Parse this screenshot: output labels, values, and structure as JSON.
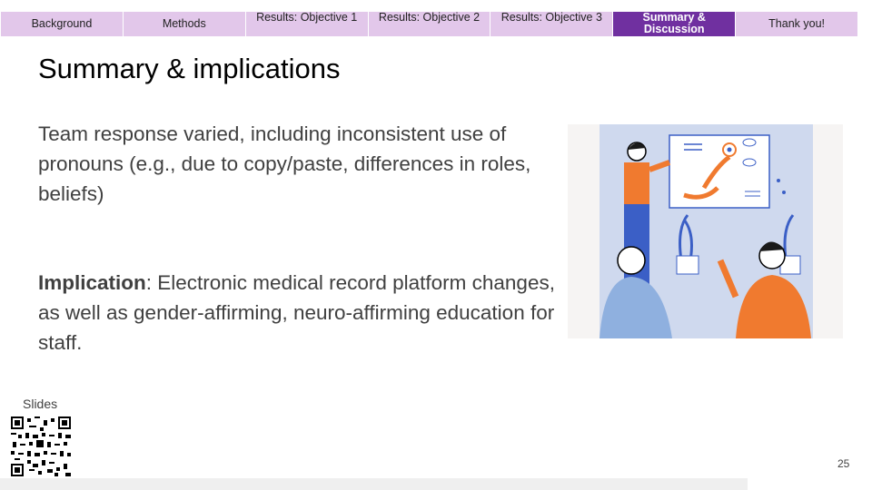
{
  "nav": {
    "tabs": [
      {
        "label": "Background",
        "active": false
      },
      {
        "label": "Methods",
        "active": false
      },
      {
        "label": "Results: Objective 1",
        "active": false
      },
      {
        "label": "Results: Objective 2",
        "active": false
      },
      {
        "label": "Results: Objective 3",
        "active": false
      },
      {
        "label": "Summary & Discussion",
        "active": true
      },
      {
        "label": "Thank you!",
        "active": false
      }
    ]
  },
  "slide": {
    "title": "Summary & implications",
    "paragraph1": "Team response varied, including inconsistent use of pronouns (e.g., due to copy/paste, differences in roles, beliefs)",
    "implication_label": "Implication",
    "implication_text": ": Electronic medical record platform changes, as well as gender-affirming, neuro-affirming education for staff.",
    "slides_label": "Slides",
    "page_number": "25"
  },
  "colors": {
    "tab_bg": "#e2c7ea",
    "tab_active_bg": "#7030a0",
    "text": "#404040",
    "illustration_orange": "#f07a2f",
    "illustration_blue": "#3b5fc6"
  }
}
